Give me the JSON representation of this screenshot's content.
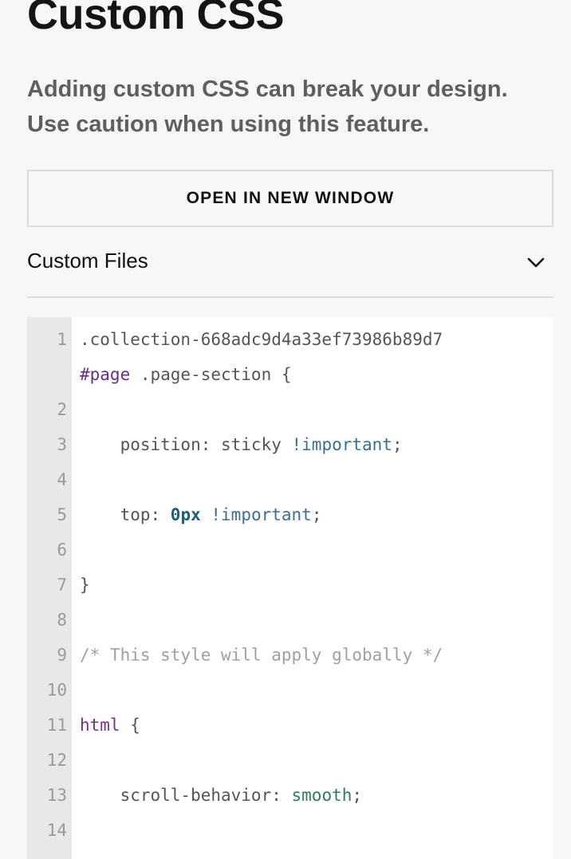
{
  "header": {
    "title": "Custom CSS",
    "warning_line1": "Adding custom CSS can break your design.",
    "warning_line2": "Use caution when using this feature."
  },
  "actions": {
    "open_new_window": "OPEN IN NEW WINDOW"
  },
  "custom_files": {
    "label": "Custom Files",
    "expand_icon": "chevron-down-icon"
  },
  "editor": {
    "lines": [
      {
        "number": "1",
        "tokens": [
          {
            "text": ".collection-668adc9d4a33ef73986b89d7",
            "type": "plain"
          }
        ]
      },
      {
        "number": "",
        "tokens": [
          {
            "text": "#page",
            "type": "id"
          },
          {
            "text": " .page-section {",
            "type": "plain"
          }
        ]
      },
      {
        "number": "2",
        "tokens": []
      },
      {
        "number": "3",
        "tokens": [
          {
            "text": "    position: sticky ",
            "type": "prop"
          },
          {
            "text": "!important",
            "type": "important"
          },
          {
            "text": ";",
            "type": "plain"
          }
        ]
      },
      {
        "number": "4",
        "tokens": []
      },
      {
        "number": "5",
        "tokens": [
          {
            "text": "    top: ",
            "type": "prop"
          },
          {
            "text": "0px",
            "type": "num"
          },
          {
            "text": " ",
            "type": "plain"
          },
          {
            "text": "!important",
            "type": "important"
          },
          {
            "text": ";",
            "type": "plain"
          }
        ]
      },
      {
        "number": "6",
        "tokens": []
      },
      {
        "number": "7",
        "tokens": [
          {
            "text": "}",
            "type": "brace"
          }
        ]
      },
      {
        "number": "8",
        "tokens": []
      },
      {
        "number": "9",
        "tokens": [
          {
            "text": "/* This style will apply globally */",
            "type": "comment"
          }
        ]
      },
      {
        "number": "10",
        "tokens": []
      },
      {
        "number": "11",
        "tokens": [
          {
            "text": "html",
            "type": "tag"
          },
          {
            "text": " {",
            "type": "brace"
          }
        ]
      },
      {
        "number": "12",
        "tokens": []
      },
      {
        "number": "13",
        "tokens": [
          {
            "text": "    scroll-behavior: ",
            "type": "prop"
          },
          {
            "text": "smooth",
            "type": "kw"
          },
          {
            "text": ";",
            "type": "plain"
          }
        ]
      },
      {
        "number": "14",
        "tokens": []
      },
      {
        "number": "",
        "tokens": []
      }
    ]
  }
}
